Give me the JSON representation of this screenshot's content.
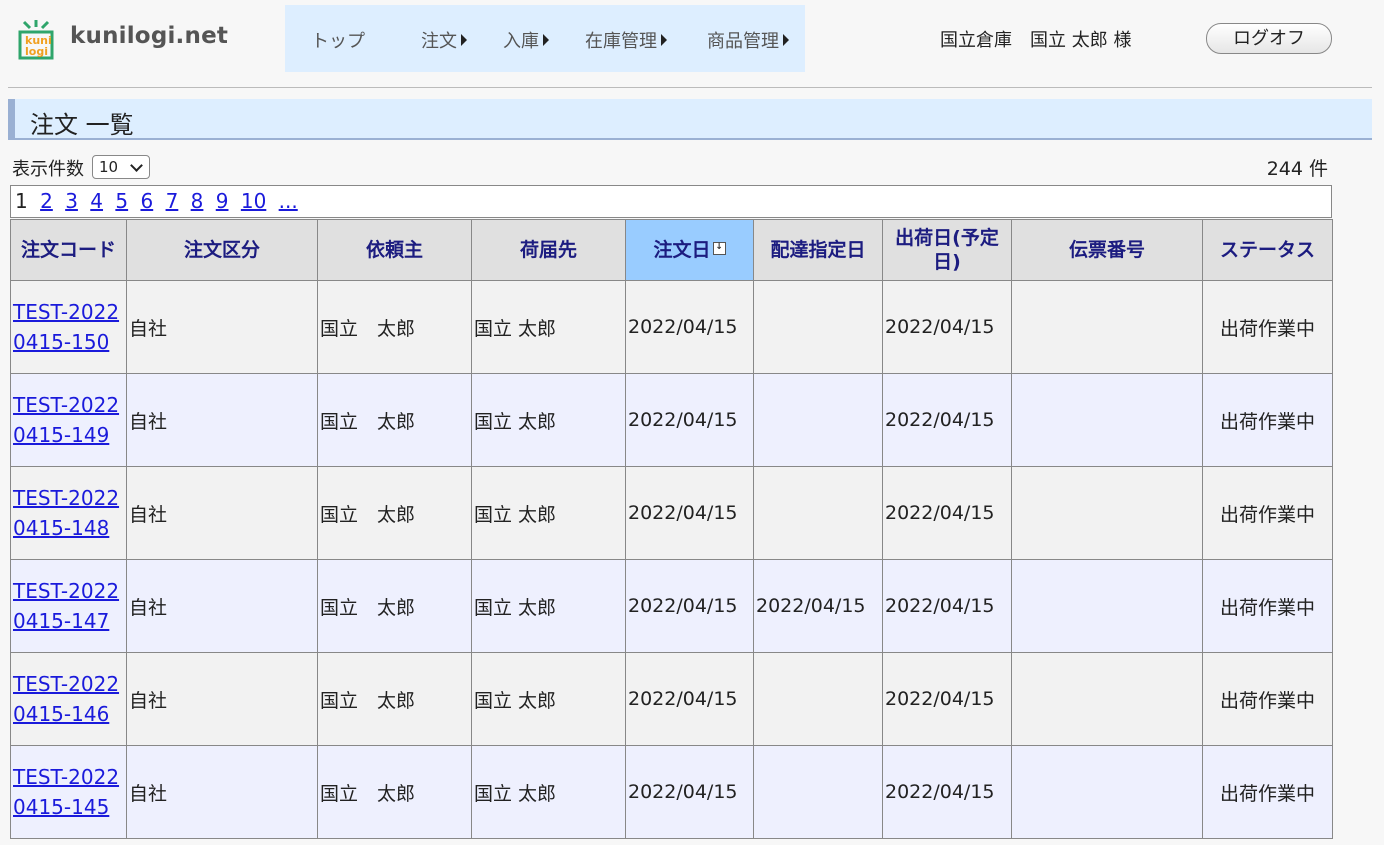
{
  "logo": {
    "text": "kunilogi.net",
    "badge_top": "kuni",
    "badge_bottom": "logi"
  },
  "nav": {
    "items": [
      {
        "label": "トップ",
        "has_arrow": false
      },
      {
        "label": "注文",
        "has_arrow": true
      },
      {
        "label": "入庫",
        "has_arrow": true
      },
      {
        "label": "在庫管理",
        "has_arrow": true
      },
      {
        "label": "商品管理",
        "has_arrow": true
      }
    ]
  },
  "user": {
    "text": "国立倉庫　国立 太郎 様"
  },
  "logoff": {
    "label": "ログオフ"
  },
  "page_title": "注文 一覧",
  "controls": {
    "per_page_label": "表示件数",
    "per_page_value": "10",
    "total_count": "244 件"
  },
  "pager": {
    "current": "1",
    "pages": [
      "2",
      "3",
      "4",
      "5",
      "6",
      "7",
      "8",
      "9",
      "10",
      "..."
    ]
  },
  "table": {
    "headers": [
      "注文コード",
      "注文区分",
      "依頼主",
      "荷届先",
      "注文日",
      "配達指定日",
      "出荷日(予定日)",
      "伝票番号",
      "ステータス"
    ],
    "sorted_column": "注文日",
    "rows": [
      {
        "code": "TEST-20220415-150",
        "type": "自社",
        "requester": "国立　太郎",
        "recipient": "国立 太郎",
        "order_date": "2022/04/15",
        "delivery_date": "",
        "ship_date": "2022/04/15",
        "slip": "",
        "status": "出荷作業中"
      },
      {
        "code": "TEST-20220415-149",
        "type": "自社",
        "requester": "国立　太郎",
        "recipient": "国立 太郎",
        "order_date": "2022/04/15",
        "delivery_date": "",
        "ship_date": "2022/04/15",
        "slip": "",
        "status": "出荷作業中"
      },
      {
        "code": "TEST-20220415-148",
        "type": "自社",
        "requester": "国立　太郎",
        "recipient": "国立 太郎",
        "order_date": "2022/04/15",
        "delivery_date": "",
        "ship_date": "2022/04/15",
        "slip": "",
        "status": "出荷作業中"
      },
      {
        "code": "TEST-20220415-147",
        "type": "自社",
        "requester": "国立　太郎",
        "recipient": "国立 太郎",
        "order_date": "2022/04/15",
        "delivery_date": "2022/04/15",
        "ship_date": "2022/04/15",
        "slip": "",
        "status": "出荷作業中"
      },
      {
        "code": "TEST-20220415-146",
        "type": "自社",
        "requester": "国立　太郎",
        "recipient": "国立 太郎",
        "order_date": "2022/04/15",
        "delivery_date": "",
        "ship_date": "2022/04/15",
        "slip": "",
        "status": "出荷作業中"
      },
      {
        "code": "TEST-20220415-145",
        "type": "自社",
        "requester": "国立　太郎",
        "recipient": "国立 太郎",
        "order_date": "2022/04/15",
        "delivery_date": "",
        "ship_date": "2022/04/15",
        "slip": "",
        "status": "出荷作業中"
      }
    ]
  },
  "colors": {
    "nav_bg": "#ddeeff",
    "title_border": "#9ab0d3",
    "sorted_header": "#99ccff",
    "link": "#1a1adb",
    "logo_green": "#2fa56b",
    "logo_orange": "#f0a020"
  }
}
